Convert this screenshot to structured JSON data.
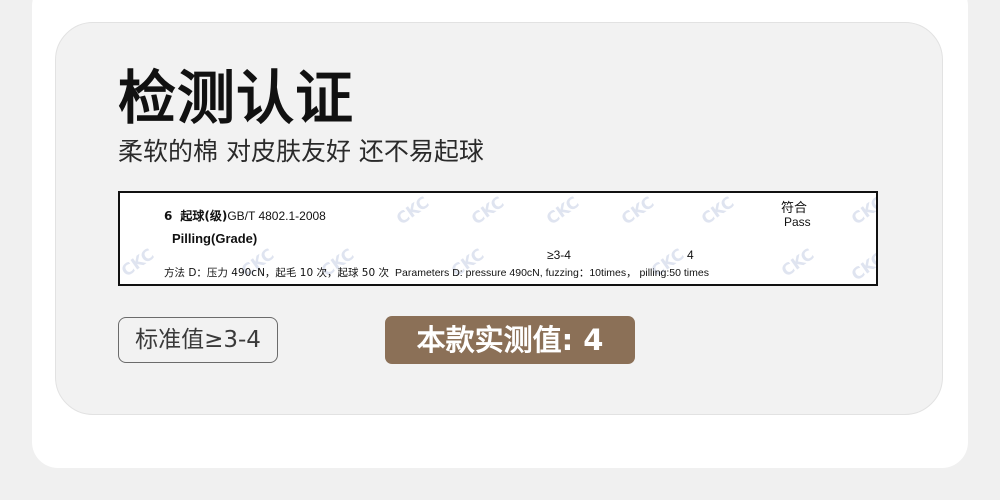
{
  "header": {
    "title": "检测认证",
    "subtitle": "柔软的棉 对皮肤友好 还不易起球"
  },
  "test_table": {
    "item_number": "6",
    "item_name_cn": "起球(级)",
    "item_standard": "GB/T 4802.1-2008",
    "item_name_en": "Pilling(Grade)",
    "result_cn": "符合",
    "result_en": "Pass",
    "standard_value": "≥3-4",
    "measured_value": "4",
    "method_cn": "方法 D：压力 490cN，起毛 10 次，起球 50 次",
    "method_en": "Parameters D: pressure 490cN, fuzzing：10times， pilling:50 times",
    "watermark_text": "CKC"
  },
  "badges": {
    "standard": "标准值≥3-4",
    "measured": "本款实测值: 4"
  },
  "colors": {
    "background": "#f0f0f0",
    "card": "#ffffff",
    "inner_card": "#f2f2f2",
    "accent_brown": "#8b7057",
    "watermark": "#dfe4f0"
  }
}
